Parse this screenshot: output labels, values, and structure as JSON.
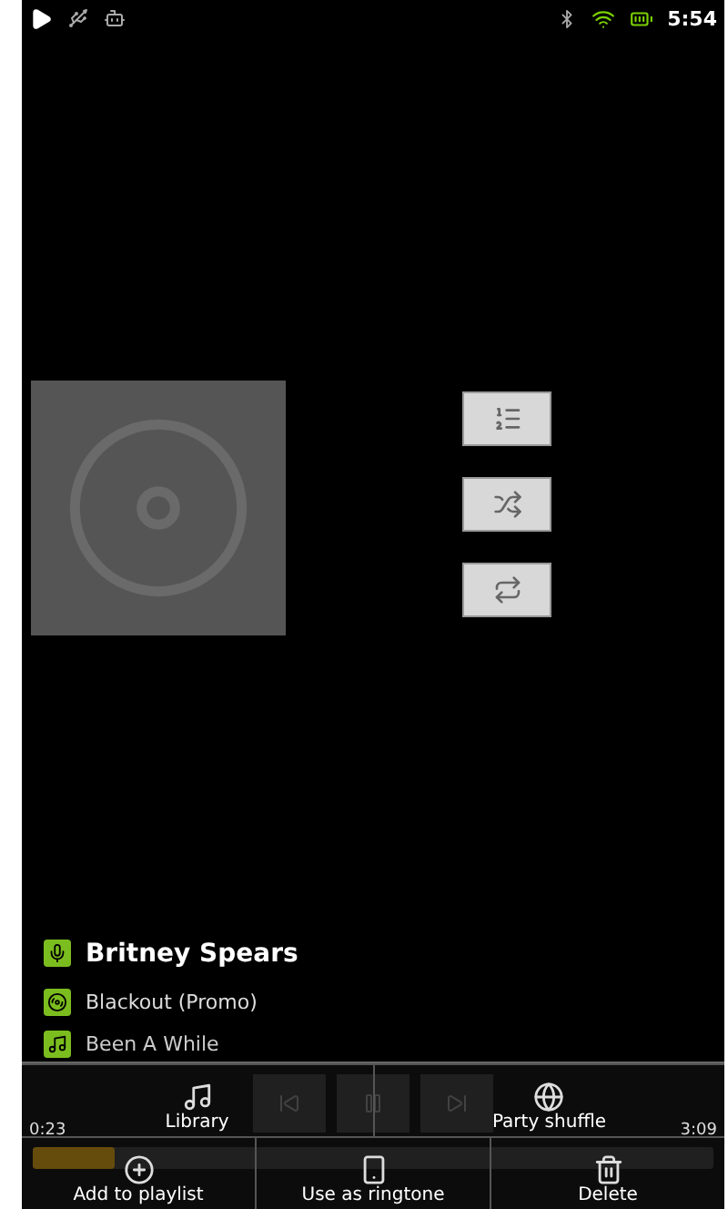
{
  "status_bar": {
    "time": "5:54"
  },
  "now_playing": {
    "artist": "Britney Spears",
    "album": "Blackout (Promo)",
    "track": "Been A While"
  },
  "progress": {
    "elapsed": "0:23",
    "total": "3:09",
    "level": 0.12
  },
  "menu": {
    "rows": [
      [
        {
          "label": "Library",
          "kind": "library"
        },
        {
          "label": "Party shuffle",
          "kind": "party"
        }
      ],
      [
        {
          "label": "Add to playlist",
          "kind": "add"
        },
        {
          "label": "Use as ringtone",
          "kind": "ringtone"
        },
        {
          "label": "Delete",
          "kind": "delete"
        }
      ]
    ]
  }
}
